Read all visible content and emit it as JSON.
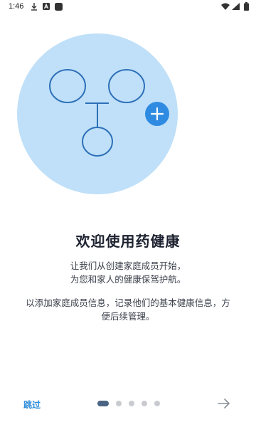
{
  "status_bar": {
    "time": "1:46",
    "icons": [
      "download-icon",
      "a-badge-icon",
      "square-app-icon",
      "wifi-icon",
      "signal-icon",
      "battery-icon"
    ]
  },
  "illustration": {
    "icons": [
      "family-tree-icon",
      "add-circle-icon"
    ],
    "colors": {
      "circle_bg": "#bfe0f8",
      "stroke": "#2d6fb8",
      "add_button": "#2f8be2"
    }
  },
  "welcome": {
    "title": "欢迎使用药健康",
    "desc1_line1": "让我们从创建家庭成员开始，",
    "desc1_line2": "为您和家人的健康保驾护航。",
    "desc2_line1": "以添加家庭成员信息，记录他们的基本健康信息，方",
    "desc2_line2": "便后续管理。"
  },
  "nav": {
    "skip_label": "跳过",
    "page_count": 5,
    "current_page": 1,
    "next_icon": "arrow-right-icon"
  }
}
